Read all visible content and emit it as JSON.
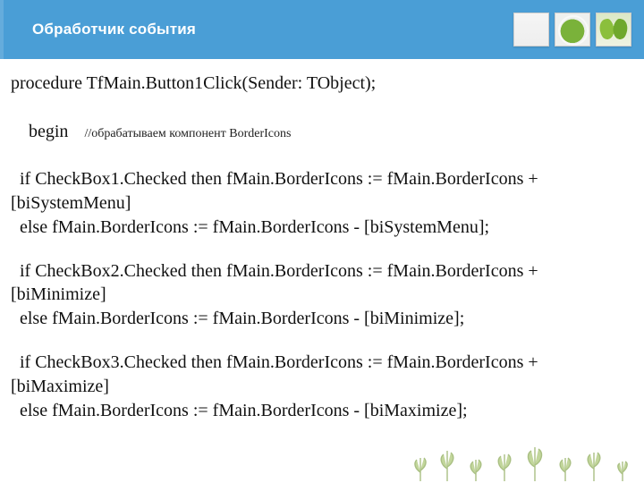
{
  "header": {
    "title": "Обработчик события"
  },
  "code": {
    "l1": "procedure TfMain.Button1Click(Sender: TObject);",
    "l2a": "begin",
    "l2b": "//обрабатываем компонент BorderIcons",
    "l3": "  if CheckBox1.Checked then fMain.BorderIcons := fMain.BorderIcons + [biSystemMenu]",
    "l4": "  else fMain.BorderIcons := fMain.BorderIcons - [biSystemMenu];",
    "l5": "  if CheckBox2.Checked then fMain.BorderIcons := fMain.BorderIcons + [biMinimize]",
    "l6": "  else fMain.BorderIcons := fMain.BorderIcons - [biMinimize];",
    "l7": "  if CheckBox3.Checked then fMain.BorderIcons := fMain.BorderIcons + [biMaximize]",
    "l8": "  else fMain.BorderIcons := fMain.BorderIcons - [biMaximize];"
  }
}
